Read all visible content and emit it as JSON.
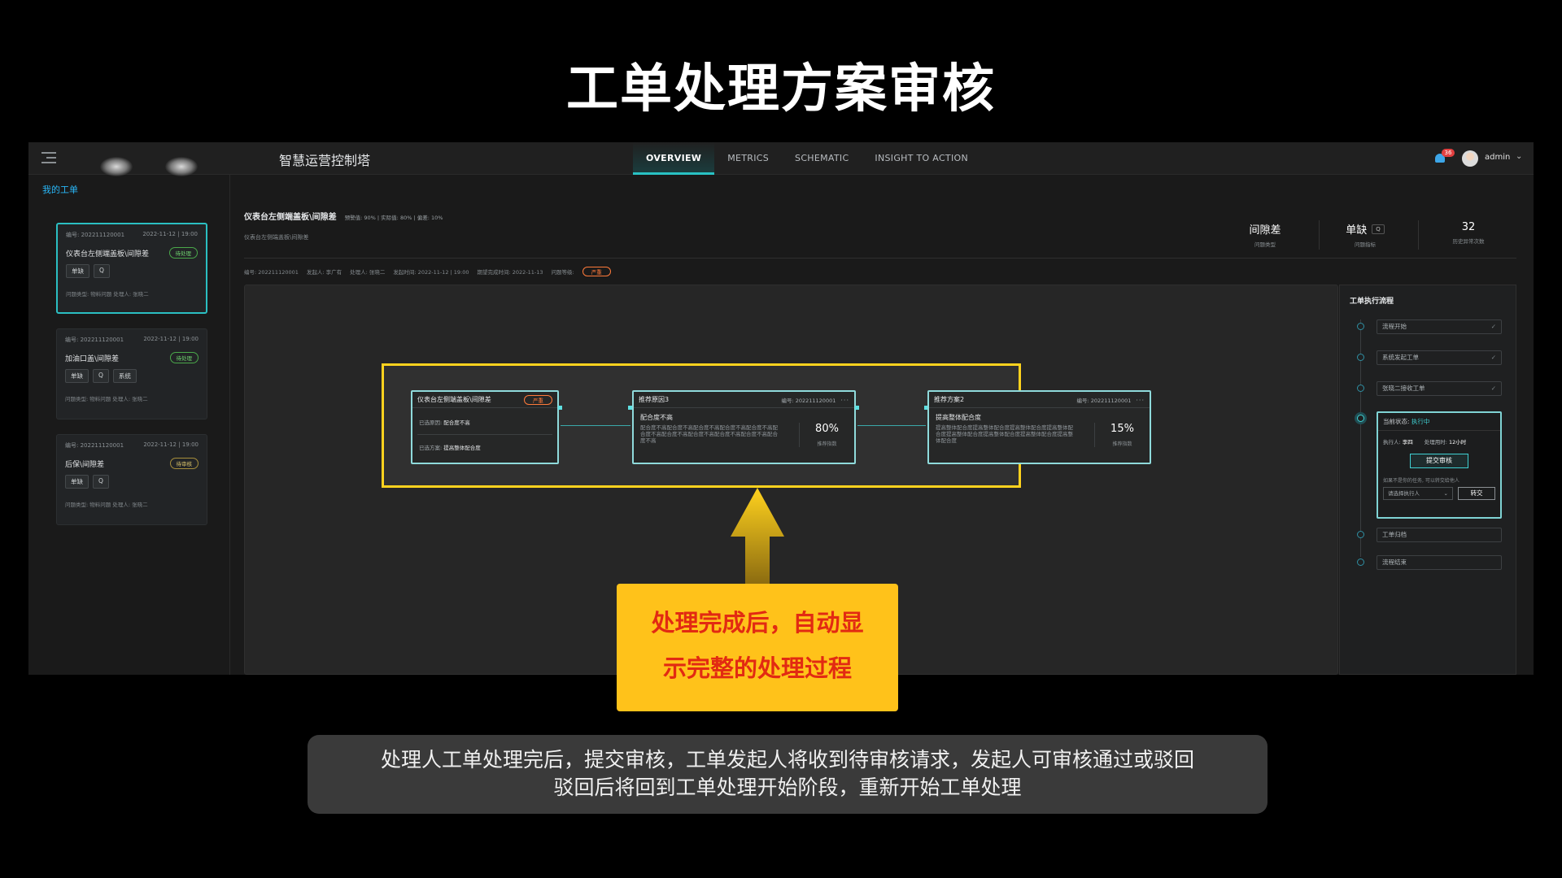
{
  "slide_title": "工单处理方案审核",
  "app": {
    "title": "智慧运营控制塔",
    "nav_tabs": [
      "OVERVIEW",
      "METRICS",
      "SCHEMATIC",
      "INSIGHT TO ACTION"
    ],
    "bell_count": "36",
    "user": "admin",
    "my_orders": "我的工单"
  },
  "orders": [
    {
      "id": "编号: 202211120001",
      "date": "2022-11-12 | 19:00",
      "name": "仪表台左侧端盖板\\间隙差",
      "status": "待处理",
      "tags": [
        "单缺",
        "Q"
      ],
      "meta": "问题类型: 物料问题     处理人: 张晓二"
    },
    {
      "id": "编号: 202211120001",
      "date": "2022-11-12 | 19:00",
      "name": "加油口盖\\间隙差",
      "status": "待处理",
      "tags": [
        "单缺",
        "Q",
        "系统"
      ],
      "meta": "问题类型: 物料问题     处理人: 张晓二"
    },
    {
      "id": "编号: 202211120001",
      "date": "2022-11-12 | 19:00",
      "name": "后保\\间隙差",
      "status": "待审核",
      "tags": [
        "单缺",
        "Q"
      ],
      "meta": "问题类型: 物料问题     处理人: 张晓二"
    }
  ],
  "detail": {
    "title": "仪表台左侧端盖板\\间隙差",
    "stats_line": "预警值: 90%  |  实际值: 80%  |  偏差: 10%",
    "subtitle": "仪表台左侧端盖板\\间隙差",
    "meta_id": "编号: 202211120001",
    "meta_initiator": "发起人: 李广有",
    "meta_handler": "处理人: 张晓二",
    "meta_time": "发起时间: 2022-11-12 | 19:00",
    "meta_deadline": "期望完成时间: 2022-11-13",
    "meta_level": "问题等级:",
    "level_tag": "严重",
    "stat1_val": "间隙差",
    "stat1_lbl": "问题类型",
    "stat2_val": "单缺",
    "stat2_tag": "Q",
    "stat2_lbl": "问题指标",
    "stat3_val": "32",
    "stat3_lbl": "历史异常次数"
  },
  "nodes": {
    "n1_title": "仪表台左侧端盖板\\间隙差",
    "n1_tag": "严重",
    "n1_cause": "已选原因: ",
    "n1_cause_val": "配合度不高",
    "n1_plan": "已选方案: ",
    "n1_plan_val": "提高整体配合度",
    "n2_title": "推荐原因3",
    "n2_id": "编号: 202211120001",
    "n2_sub": "配合度不高",
    "n2_desc": "配合度不高配合度不高配合度不高配合度不高配合度不高配合度不高配合度不高配合度不高配合度不高配合度不高配合度不高",
    "n2_pct": "80%",
    "n2_lbl": "推荐指数",
    "n3_title": "推荐方案2",
    "n3_id": "编号: 202211120001",
    "n3_sub": "提高整体配合度",
    "n3_desc": "提高整体配合度提高整体配合度提高整体配合度提高整体配合度提高整体配合度提高整体配合度提高整体配合度提高整体配合度",
    "n3_pct": "15%",
    "n3_lbl": "推荐指数"
  },
  "flow": {
    "title": "工单执行流程",
    "steps": [
      "流程开始",
      "系统发起工单",
      "张晓二接收工单",
      "工单归档",
      "流程结束"
    ],
    "current_label": "当前状态: ",
    "current_state": "执行中",
    "executor_lbl": "执行人: ",
    "executor": "李四",
    "duration_lbl": "处理用时: ",
    "duration": "12小时",
    "submit": "提交审核",
    "hint": "如果不是你的任务, 可以转交给他人",
    "select_placeholder": "请选择执行人",
    "transfer": "转交"
  },
  "callout": {
    "line1": "处理完成后，自动显",
    "line2": "示完整的处理过程"
  },
  "caption": {
    "line1": "处理人工单处理完后，提交审核，工单发起人将收到待审核请求，发起人可审核通过或驳回",
    "line2": "驳回后将回到工单处理开始阶段，重新开始工单处理"
  }
}
